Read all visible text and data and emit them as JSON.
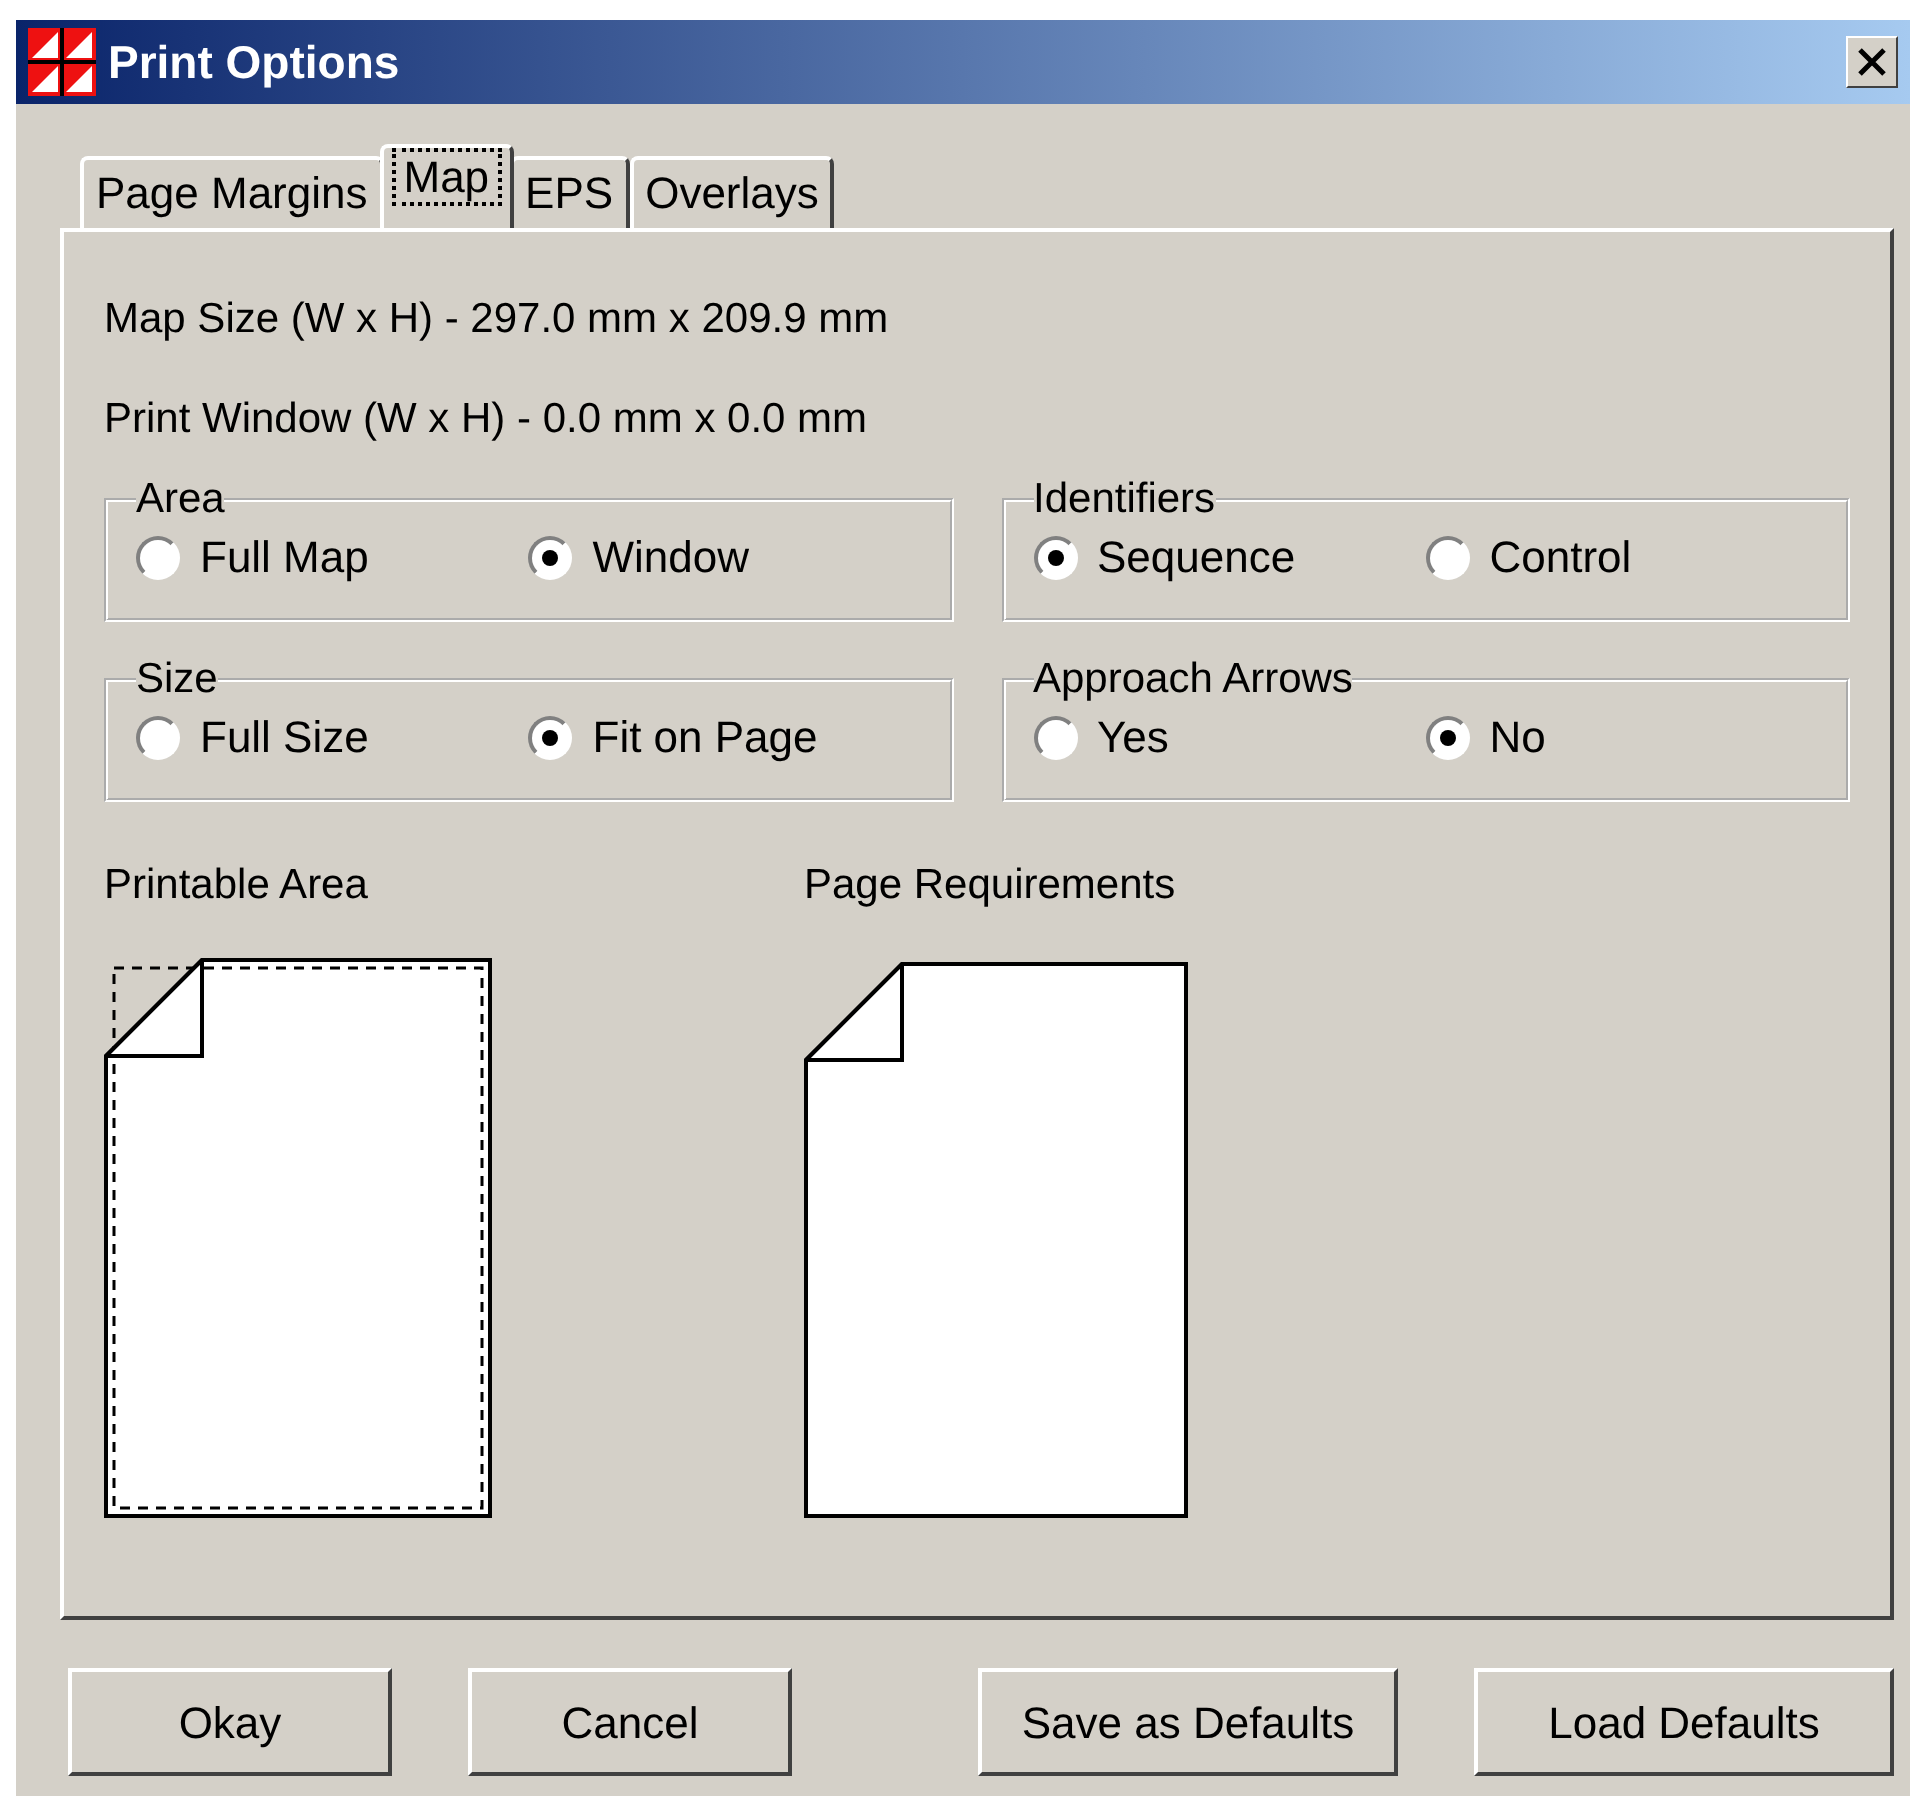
{
  "window": {
    "title": "Print Options"
  },
  "tabs": [
    {
      "label": "Page Margins",
      "selected": false
    },
    {
      "label": "Map",
      "selected": true
    },
    {
      "label": "EPS",
      "selected": false
    },
    {
      "label": "Overlays",
      "selected": false
    }
  ],
  "info": [
    "Map Size (W x H) - 297.0 mm x 209.9 mm",
    "Print Window (W x H) - 0.0 mm x 0.0 mm"
  ],
  "groups": [
    {
      "title": "Area",
      "options": [
        {
          "label": "Full Map",
          "selected": false
        },
        {
          "label": "Window",
          "selected": true
        }
      ]
    },
    {
      "title": "Identifiers",
      "options": [
        {
          "label": "Sequence",
          "selected": true
        },
        {
          "label": "Control",
          "selected": false
        }
      ]
    },
    {
      "title": "Size",
      "options": [
        {
          "label": "Full Size",
          "selected": false
        },
        {
          "label": "Fit on Page",
          "selected": true
        }
      ]
    },
    {
      "title": "Approach Arrows",
      "options": [
        {
          "label": "Yes",
          "selected": false
        },
        {
          "label": "No",
          "selected": true
        }
      ]
    }
  ],
  "previews": [
    {
      "label": "Printable Area",
      "kind": "printable"
    },
    {
      "label": "Page Requirements",
      "kind": "page"
    }
  ],
  "buttons_left": [
    "Okay",
    "Cancel"
  ],
  "buttons_right": [
    "Save as Defaults",
    "Load Defaults"
  ]
}
